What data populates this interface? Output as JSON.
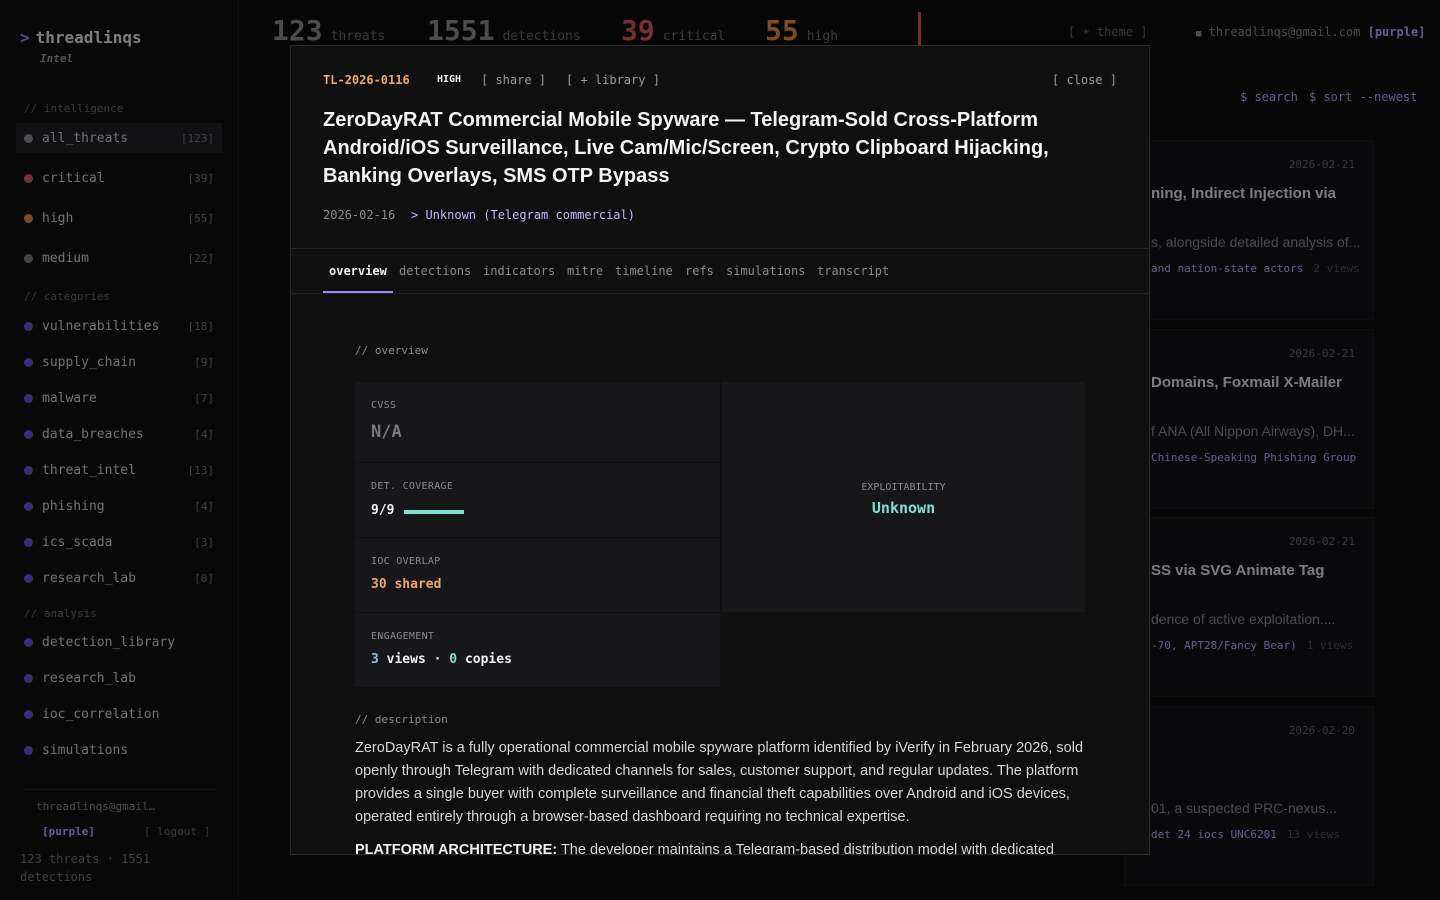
{
  "app": {
    "name": "threadlinqs",
    "subtitle": "Intel"
  },
  "sidebar": {
    "sections": {
      "intelligence": "// intelligence",
      "categories": "// categories",
      "analysis": "// analysis"
    },
    "severity_items": [
      {
        "label": "all_threats",
        "count": "[123]",
        "color": "#8a8a92"
      },
      {
        "label": "critical",
        "count": "[39]",
        "color": "#d45a5a"
      },
      {
        "label": "high",
        "count": "[55]",
        "color": "#e08a3c"
      },
      {
        "label": "medium",
        "count": "[22]",
        "color": "#7a7a84"
      }
    ],
    "category_items": [
      {
        "label": "vulnerabilities",
        "count": "[18]"
      },
      {
        "label": "supply_chain",
        "count": "[9]"
      },
      {
        "label": "malware",
        "count": "[7]"
      },
      {
        "label": "data_breaches",
        "count": "[4]"
      },
      {
        "label": "threat_intel",
        "count": "[13]"
      },
      {
        "label": "phishing",
        "count": "[4]"
      },
      {
        "label": "ics_scada",
        "count": "[3]"
      },
      {
        "label": "research_lab",
        "count": "[0]"
      }
    ],
    "analysis_items": [
      {
        "label": "detection_library"
      },
      {
        "label": "research_lab"
      },
      {
        "label": "ioc_correlation"
      },
      {
        "label": "simulations"
      }
    ],
    "category_color": "#6a4fe0",
    "user_email": "threadlinqs@gmail…",
    "user_tier": "[purple]",
    "logout": "[ logout ]",
    "stats": "123 threats · 1551 detections"
  },
  "topbar": {
    "stats": [
      {
        "num": "123",
        "label": "threats",
        "color": "#8a8a92"
      },
      {
        "num": "1551",
        "label": "detections",
        "color": "#8a8a92"
      },
      {
        "num": "39",
        "label": "critical",
        "color": "#d45a5a"
      },
      {
        "num": "55",
        "label": "high",
        "color": "#e08a3c"
      }
    ],
    "theme": "[ ☀ theme ]",
    "email": "threadlinqs@gmail.com",
    "tier": "[purple]",
    "search": "$ search",
    "sort": "$ sort --newest"
  },
  "background_cards": [
    {
      "date": "2026-02-21",
      "title": "ning, Indirect Injection via",
      "desc": "s, alongside detailed analysis of...",
      "meta": "and nation-state actors",
      "views": "2 views"
    },
    {
      "date": "2026-02-21",
      "title": "Domains, Foxmail X-Mailer",
      "desc": "f ANA (All Nippon Airways), DH...",
      "meta": "Chinese-Speaking Phishing Group",
      "views": ""
    },
    {
      "date": "2026-02-21",
      "title": "SS via SVG Animate Tag",
      "desc": "dence of active exploitation....",
      "meta": "-70, APT28/Fancy Bear)",
      "views": "1 views"
    },
    {
      "date": "2026-02-20",
      "title": "",
      "desc": "01, a suspected PRC-nexus...",
      "meta": "det  24 iocs  UNC6201",
      "views": "13 views"
    }
  ],
  "modal": {
    "id": "TL-2026-0116",
    "severity": "HIGH",
    "share": "[ share ]",
    "library": "[ + library ]",
    "close": "[ close ]",
    "title": "ZeroDayRAT Commercial Mobile Spyware — Telegram-Sold Cross-Platform Android/iOS Surveillance, Live Cam/Mic/Screen, Crypto Clipboard Hijacking, Banking Overlays, SMS OTP Bypass",
    "date": "2026-02-16",
    "actor": "> Unknown (Telegram commercial)",
    "tabs": [
      "overview",
      "detections",
      "indicators",
      "mitre",
      "timeline",
      "refs",
      "simulations",
      "transcript"
    ],
    "overview_label": "// overview",
    "cvss_label": "CVSS",
    "cvss_value": "N/A",
    "coverage_label": "DET. COVERAGE",
    "coverage_value": "9/9",
    "coverage_fraction": 1.0,
    "ioc_label": "IOC OVERLAP",
    "ioc_value": "30 shared",
    "engagement_label": "ENGAGEMENT",
    "engagement_views": "3",
    "engagement_views_label": "views",
    "engagement_sep": "·",
    "engagement_copies": "0",
    "engagement_copies_label": "copies",
    "exploitability_label": "EXPLOITABILITY",
    "exploitability_value": "Unknown",
    "description_label": "// description",
    "description": "ZeroDayRAT is a fully operational commercial mobile spyware platform identified by iVerify in February 2026, sold openly through Telegram with dedicated channels for sales, customer support, and regular updates. The platform provides a single buyer with complete surveillance and financial theft capabilities over Android and iOS devices, operated entirely through a browser-based dashboard requiring no technical expertise.",
    "platform_heading": "PLATFORM ARCHITECTURE:",
    "platform_text": " The developer maintains a Telegram-based distribution model with dedicated"
  },
  "colors": {
    "accent": "#9a8cf0",
    "teal": "#7fe0cf",
    "orange": "#f0a860",
    "lavender": "#c4b5ff"
  }
}
